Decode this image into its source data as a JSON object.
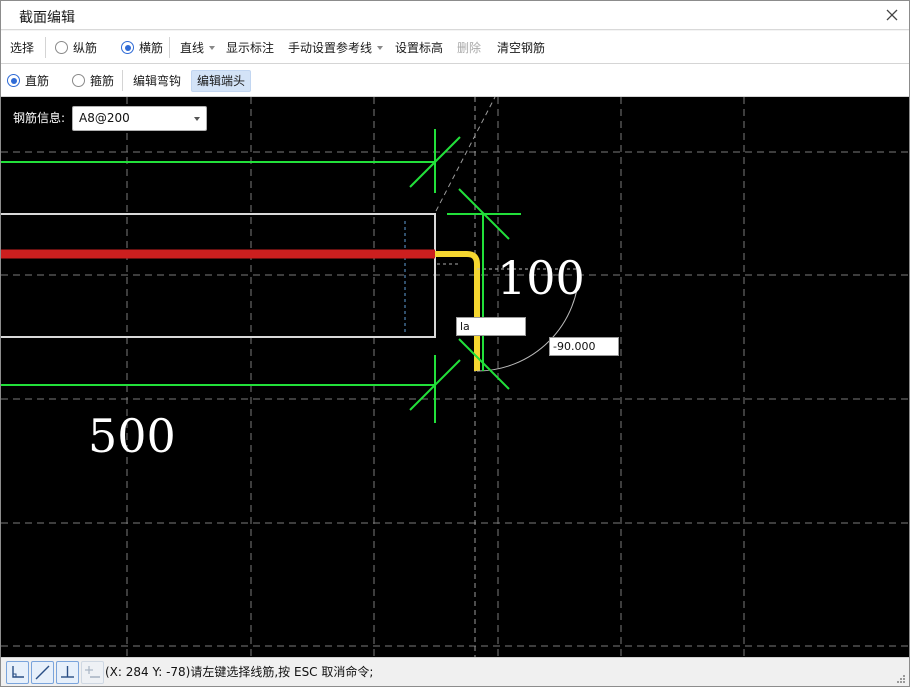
{
  "window": {
    "title": "截面编辑"
  },
  "toolbar1": {
    "select": "选择",
    "longitudinal": "纵筋",
    "transverse": "横筋",
    "line": "直线",
    "show_annotation": "显示标注",
    "manual_reference": "手动设置参考线",
    "set_elevation": "设置标高",
    "delete": "删除",
    "clear_rebar": "清空钢筋"
  },
  "toolbar2": {
    "straight": "直筋",
    "stirrup": "箍筋",
    "edit_hook": "编辑弯钩",
    "edit_end": "编辑端头"
  },
  "canvas": {
    "rebar_info_label": "钢筋信息:",
    "rebar_info_value": "A8@200",
    "dim_right": "100",
    "dim_bottom": "500",
    "length_input": "la",
    "angle_input": "-90.000"
  },
  "colors": {
    "rebar_main": "#cc1f1f",
    "rebar_end": "#f5d630",
    "dimension": "#22e03a",
    "grid": "#7a7a7a",
    "outline": "#d9d9d9",
    "accent": "#2f6bd6"
  },
  "status": {
    "prompt": "(X: 284 Y: -78)请左键选择线筋,按 ESC 取消命令;"
  }
}
